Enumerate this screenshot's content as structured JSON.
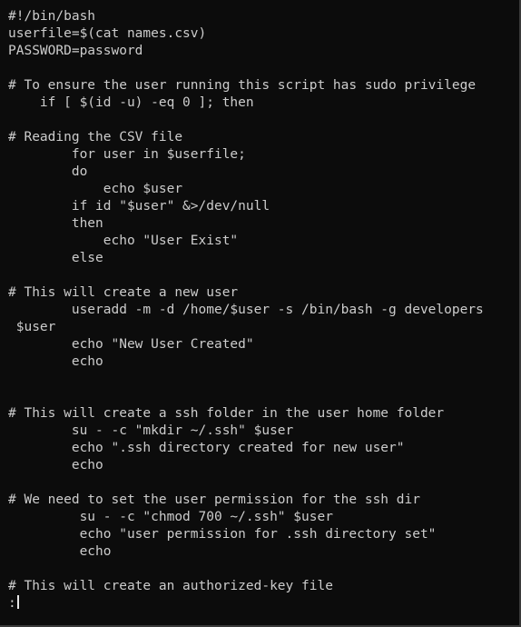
{
  "terminal": {
    "lines": [
      "#!/bin/bash",
      "userfile=$(cat names.csv)",
      "PASSWORD=password",
      "",
      "# To ensure the user running this script has sudo privilege",
      "    if [ $(id -u) -eq 0 ]; then",
      "",
      "# Reading the CSV file",
      "        for user in $userfile;",
      "        do",
      "            echo $user",
      "        if id \"$user\" &>/dev/null",
      "        then",
      "            echo \"User Exist\"",
      "        else",
      "",
      "# This will create a new user",
      "        useradd -m -d /home/$user -s /bin/bash -g developers",
      " $user",
      "        echo \"New User Created\"",
      "        echo",
      "",
      "",
      "# This will create a ssh folder in the user home folder",
      "        su - -c \"mkdir ~/.ssh\" $user",
      "        echo \".ssh directory created for new user\"",
      "        echo",
      "",
      "# We need to set the user permission for the ssh dir",
      "         su - -c \"chmod 700 ~/.ssh\" $user",
      "         echo \"user permission for .ssh directory set\"",
      "         echo",
      "",
      "# This will create an authorized-key file"
    ],
    "prompt": ":"
  }
}
